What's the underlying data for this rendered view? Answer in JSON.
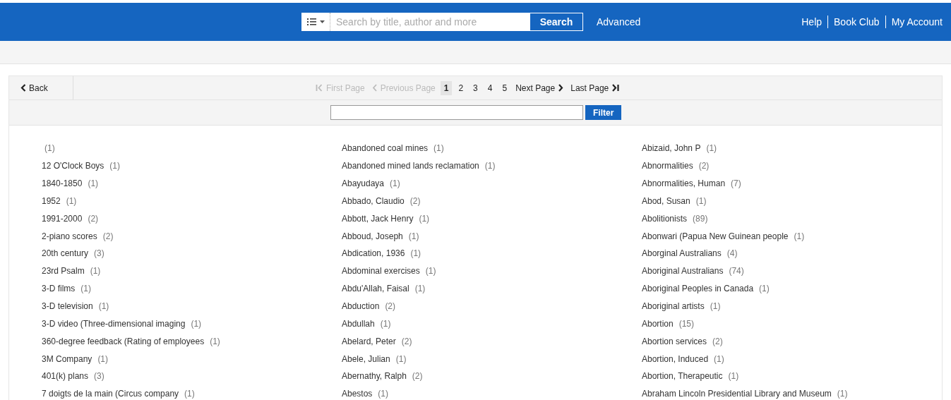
{
  "header": {
    "search": {
      "placeholder": "Search by title, author and more",
      "button": "Search"
    },
    "advanced": "Advanced",
    "links": [
      "Help",
      "Book Club",
      "My Account"
    ]
  },
  "toolbar": {
    "back": "Back",
    "first": {
      "label": "First Page",
      "disabled": true
    },
    "previous": {
      "label": "Previous Page",
      "disabled": true
    },
    "pages": [
      {
        "label": "1",
        "selected": true
      },
      {
        "label": "2",
        "selected": false
      },
      {
        "label": "3",
        "selected": false
      },
      {
        "label": "4",
        "selected": false
      },
      {
        "label": "5",
        "selected": false
      }
    ],
    "next": {
      "label": "Next Page",
      "disabled": false
    },
    "last": {
      "label": "Last Page",
      "disabled": false
    }
  },
  "filter": {
    "button": "Filter"
  },
  "columns": [
    [
      {
        "count": "(1)"
      },
      {
        "term": "12 O'Clock Boys",
        "count": "(1)"
      },
      {
        "term": "1840-1850",
        "count": "(1)"
      },
      {
        "term": "1952",
        "count": "(1)"
      },
      {
        "term": "1991-2000",
        "count": "(2)"
      },
      {
        "term": "2-piano scores",
        "count": "(2)"
      },
      {
        "term": "20th century",
        "count": "(3)"
      },
      {
        "term": "23rd Psalm",
        "count": "(1)"
      },
      {
        "term": "3-D films",
        "count": "(1)"
      },
      {
        "term": "3-D television",
        "count": "(1)"
      },
      {
        "term": "3-D video (Three-dimensional imaging",
        "count": "(1)"
      },
      {
        "term": "360-degree feedback (Rating of employees",
        "count": "(1)"
      },
      {
        "term": "3M Company",
        "count": "(1)"
      },
      {
        "term": "401(k) plans",
        "count": "(3)"
      },
      {
        "term": "7 doigts de la main (Circus company",
        "count": "(1)"
      }
    ],
    [
      {
        "term": "Abandoned coal mines",
        "count": "(1)"
      },
      {
        "term": "Abandoned mined lands reclamation",
        "count": "(1)"
      },
      {
        "term": "Abayudaya",
        "count": "(1)"
      },
      {
        "term": "Abbado, Claudio",
        "count": "(2)"
      },
      {
        "term": "Abbott, Jack Henry",
        "count": "(1)"
      },
      {
        "term": "Abboud, Joseph",
        "count": "(1)"
      },
      {
        "term": "Abdication, 1936",
        "count": "(1)"
      },
      {
        "term": "Abdominal exercises",
        "count": "(1)"
      },
      {
        "term": "Abdu'Allah, Faisal",
        "count": "(1)"
      },
      {
        "term": "Abduction",
        "count": "(2)"
      },
      {
        "term": "Abdullah",
        "count": "(1)"
      },
      {
        "term": "Abelard, Peter",
        "count": "(2)"
      },
      {
        "term": "Abele, Julian",
        "count": "(1)"
      },
      {
        "term": "Abernathy, Ralph",
        "count": "(2)"
      },
      {
        "term": "Abestos",
        "count": "(1)"
      }
    ],
    [
      {
        "term": "Abizaid, John P",
        "count": "(1)"
      },
      {
        "term": "Abnormalities",
        "count": "(2)"
      },
      {
        "term": "Abnormalities, Human",
        "count": "(7)"
      },
      {
        "term": "Abod, Susan",
        "count": "(1)"
      },
      {
        "term": "Abolitionists",
        "count": "(89)"
      },
      {
        "term": "Abonwari (Papua New Guinean people",
        "count": "(1)"
      },
      {
        "term": "Aborginal Australians",
        "count": "(4)"
      },
      {
        "term": "Aboriginal Australians",
        "count": "(74)"
      },
      {
        "term": "Aboriginal Peoples in Canada",
        "count": "(1)"
      },
      {
        "term": "Aboriginal artists",
        "count": "(1)"
      },
      {
        "term": "Abortion",
        "count": "(15)"
      },
      {
        "term": "Abortion services",
        "count": "(2)"
      },
      {
        "term": "Abortion, Induced",
        "count": "(1)"
      },
      {
        "term": "Abortion, Therapeutic",
        "count": "(1)"
      },
      {
        "term": "Abraham Lincoln Presidential Library and Museum",
        "count": "(1)"
      }
    ]
  ]
}
